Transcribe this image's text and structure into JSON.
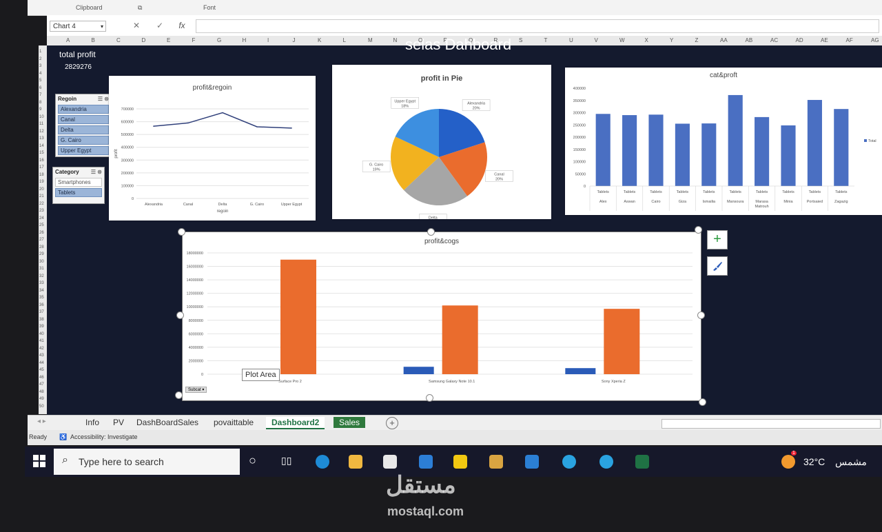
{
  "ribbon": {
    "clipboard_label": "Clipboard",
    "font_label": "Font"
  },
  "formula_bar": {
    "name_box": "Chart 4",
    "cancel": "✕",
    "enter": "✓",
    "fx": "fx",
    "formula": ""
  },
  "columns": [
    "A",
    "B",
    "C",
    "D",
    "E",
    "F",
    "G",
    "H",
    "I",
    "J",
    "K",
    "L",
    "M",
    "N",
    "O",
    "P",
    "Q",
    "R",
    "S",
    "T",
    "U",
    "V",
    "W",
    "X",
    "Y",
    "Z",
    "AA",
    "AB",
    "AC",
    "AD",
    "AE",
    "AF",
    "AG"
  ],
  "dashboard": {
    "title": "selas Dahboard",
    "kpi_label": "total profit",
    "kpi_value": "2829276"
  },
  "slicers": {
    "region": {
      "title": "Regoin",
      "items": [
        {
          "label": "Alexandria",
          "selected": true
        },
        {
          "label": "Canal",
          "selected": true
        },
        {
          "label": "Delta",
          "selected": true
        },
        {
          "label": "G. Cairo",
          "selected": true
        },
        {
          "label": "Upper Egypt",
          "selected": true
        }
      ]
    },
    "category": {
      "title": "Category",
      "items": [
        {
          "label": "Smartphones",
          "selected": false
        },
        {
          "label": "Tablets",
          "selected": true
        }
      ]
    }
  },
  "chart_data": [
    {
      "type": "line",
      "title": "profit&regoin",
      "xlabel": "regoin",
      "ylabel": "profit",
      "categories": [
        "Alexandria",
        "Canal",
        "Delta",
        "G. Cairo",
        "Upper Egypt"
      ],
      "values": [
        565000,
        590000,
        670000,
        560000,
        550000
      ],
      "ylim": [
        0,
        700000
      ],
      "yticks": [
        "0",
        "100000",
        "200000",
        "300000",
        "400000",
        "500000",
        "600000",
        "700000"
      ],
      "color": "#2f3f7a"
    },
    {
      "type": "pie",
      "title": "profit in Pie",
      "slices": [
        {
          "label": "Alexandria",
          "pct": "20%",
          "value": 20,
          "color": "#2460c8"
        },
        {
          "label": "Canal",
          "pct": "20%",
          "value": 20,
          "color": "#ea6c2d"
        },
        {
          "label": "Delta",
          "pct": "23%",
          "value": 23,
          "color": "#a6a6a6"
        },
        {
          "label": "G. Cairo",
          "pct": "19%",
          "value": 19,
          "color": "#f2b21f"
        },
        {
          "label": "Upper Egypt",
          "pct": "18%",
          "value": 18,
          "color": "#3d8fe0"
        }
      ]
    },
    {
      "type": "bar",
      "title": "cat&proft",
      "legend": "Total",
      "categories": [
        {
          "top": "Tablets",
          "bottom": "Alex"
        },
        {
          "top": "Tablets",
          "bottom": "Aswan"
        },
        {
          "top": "Tablets",
          "bottom": "Cairo"
        },
        {
          "top": "Tablets",
          "bottom": "Giza"
        },
        {
          "top": "Tablets",
          "bottom": "Ismailia"
        },
        {
          "top": "Tablets",
          "bottom": "Mansoura"
        },
        {
          "top": "Tablets",
          "bottom": "Marasa Matrouh"
        },
        {
          "top": "Tablets",
          "bottom": "Minia"
        },
        {
          "top": "Tablets",
          "bottom": "Portsaied"
        },
        {
          "top": "Tablets",
          "bottom": "Zagazig"
        }
      ],
      "values": [
        295000,
        290000,
        292000,
        255000,
        256000,
        372000,
        282000,
        248000,
        352000,
        315000
      ],
      "ylim": [
        0,
        400000
      ],
      "yticks": [
        "0",
        "50000",
        "100000",
        "150000",
        "200000",
        "250000",
        "300000",
        "350000",
        "400000"
      ],
      "color": "#4a6fc2"
    },
    {
      "type": "bar",
      "title": "profit&cogs",
      "categories": [
        "Surface Pro 2",
        "Samsung Galaxy Note 10.1",
        "Sony Xperia Z"
      ],
      "series": [
        {
          "name": "profit",
          "values": [
            800000,
            1100000,
            900000
          ],
          "color": "#2a5bb8"
        },
        {
          "name": "cogs",
          "values": [
            17000000,
            10200000,
            9700000
          ],
          "color": "#ea6c2d"
        }
      ],
      "ylim": [
        0,
        18000000
      ],
      "yticks": [
        "0",
        "2000000",
        "4000000",
        "6000000",
        "8000000",
        "10000000",
        "12000000",
        "14000000",
        "16000000",
        "18000000"
      ],
      "filter_button": "Subcat"
    }
  ],
  "tooltip": "Plot Area",
  "side_buttons": {
    "add": "+",
    "style": "brush-icon"
  },
  "tabs": [
    {
      "label": "Info"
    },
    {
      "label": "PV"
    },
    {
      "label": "DashBoardSales"
    },
    {
      "label": "povaittable"
    },
    {
      "label": "Dashboard2",
      "active": true
    },
    {
      "label": "Sales",
      "green": true
    }
  ],
  "status": {
    "ready": "Ready",
    "accessibility": "Accessibility: Investigate"
  },
  "taskbar": {
    "search_placeholder": "Type here to search",
    "temp": "32°C",
    "weather": "مشمس",
    "badge": "1"
  },
  "watermark": {
    "arabic": "مستقل",
    "latin": "mostaql.com"
  }
}
